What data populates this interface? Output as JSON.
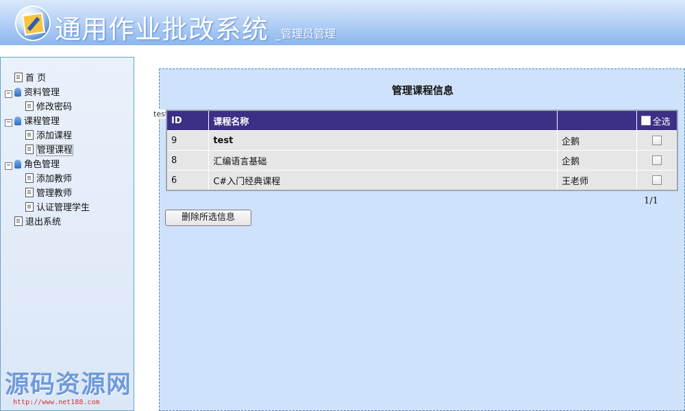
{
  "header": {
    "title": "通用作业批改系统",
    "subtitle": "_管理员管理"
  },
  "sidebar": {
    "items": [
      {
        "label": "首 页",
        "type": "doc",
        "level": 0
      },
      {
        "label": "资料管理",
        "type": "group",
        "toggle": "⊟"
      },
      {
        "label": "修改密码",
        "type": "doc",
        "level": 1
      },
      {
        "label": "课程管理",
        "type": "group",
        "toggle": "⊟"
      },
      {
        "label": "添加课程",
        "type": "doc",
        "level": 1
      },
      {
        "label": "管理课程",
        "type": "doc",
        "level": 1,
        "selected": true
      },
      {
        "label": "角色管理",
        "type": "group",
        "toggle": "⊟"
      },
      {
        "label": "添加教师",
        "type": "doc",
        "level": 1
      },
      {
        "label": "管理教师",
        "type": "doc",
        "level": 1
      },
      {
        "label": "认证管理学生",
        "type": "doc",
        "level": 1
      },
      {
        "label": "退出系统",
        "type": "doc",
        "level": 0
      }
    ]
  },
  "main": {
    "title": "管理课程信息",
    "stray_text": "test",
    "table": {
      "headers": {
        "id": "ID",
        "name": "课程名称",
        "teacher": "",
        "select_all": "全选"
      },
      "rows": [
        {
          "id": "9",
          "name": "test",
          "teacher": "企鹅"
        },
        {
          "id": "8",
          "name": "汇编语言基础",
          "teacher": "企鹅"
        },
        {
          "id": "6",
          "name": "C#入门经典课程",
          "teacher": "王老师"
        }
      ]
    },
    "pager": "1/1",
    "delete_button": "删除所选信息"
  },
  "watermark": {
    "text": "源码资源网",
    "url": "http://www.net188.com"
  },
  "colors": {
    "table_header": "#3c2f86",
    "main_bg": "#cfe2fb",
    "header_gradient_end": "#8cb6ee"
  }
}
